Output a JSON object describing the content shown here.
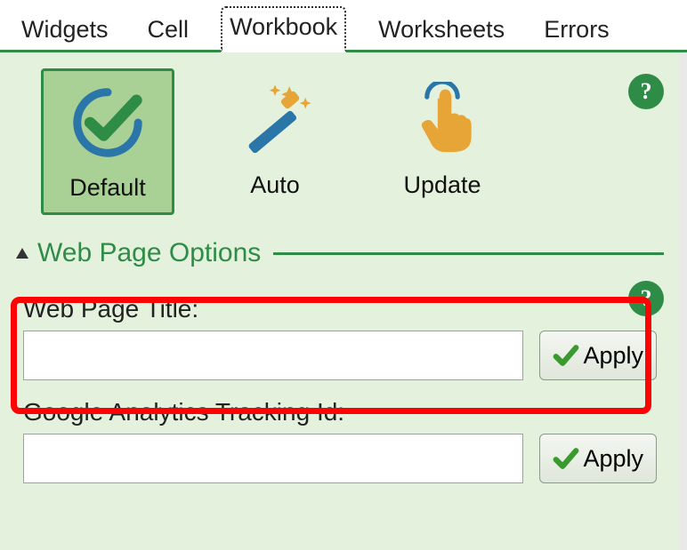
{
  "tabs": {
    "items": [
      {
        "label": "Widgets"
      },
      {
        "label": "Cell"
      },
      {
        "label": "Workbook"
      },
      {
        "label": "Worksheets"
      },
      {
        "label": "Errors"
      }
    ],
    "active_index": 2
  },
  "toolbar": {
    "default_label": "Default",
    "auto_label": "Auto",
    "update_label": "Update"
  },
  "section": {
    "web_page_options": "Web Page Options"
  },
  "fields": {
    "web_page_title": {
      "label": "Web Page Title:",
      "value": "",
      "apply_label": "Apply"
    },
    "ga_tracking": {
      "label": "Google Analytics Tracking Id:",
      "value": "",
      "apply_label": "Apply"
    }
  },
  "help_glyph": "?"
}
